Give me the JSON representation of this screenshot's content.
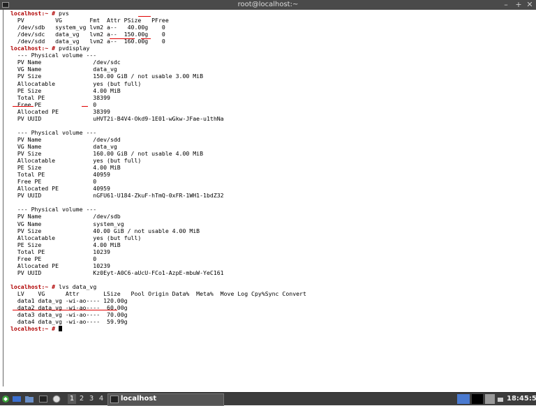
{
  "window": {
    "title": "root@localhost:~",
    "minimize": "–",
    "maximize": "+",
    "close": "✕"
  },
  "terminal": {
    "lines": [
      {
        "prompt": "localhost:~ #",
        "text": " pvs"
      },
      {
        "text": "  PV         VG        Fmt  Attr PSize   PFree"
      },
      {
        "text": "  /dev/sdb   system_vg lvm2 a--   40.00g    0"
      },
      {
        "text": "  /dev/sdc   data_vg   lvm2 a--  150.00g    0"
      },
      {
        "text": "  /dev/sdd   data_vg   lvm2 a--  160.00g    0"
      },
      {
        "prompt": "localhost:~ #",
        "text": " pvdisplay"
      },
      {
        "text": "  --- Physical volume ---"
      },
      {
        "text": "  PV Name               /dev/sdc"
      },
      {
        "text": "  VG Name               data_vg"
      },
      {
        "text": "  PV Size               150.00 GiB / not usable 3.00 MiB"
      },
      {
        "text": "  Allocatable           yes (but full)"
      },
      {
        "text": "  PE Size               4.00 MiB"
      },
      {
        "text": "  Total PE              38399"
      },
      {
        "text": "  Free PE               0"
      },
      {
        "text": "  Allocated PE          38399"
      },
      {
        "text": "  PV UUID               uHVT2i-B4V4-Okd9-1E01-wGkw-JFae-u1thNa"
      },
      {
        "text": ""
      },
      {
        "text": "  --- Physical volume ---"
      },
      {
        "text": "  PV Name               /dev/sdd"
      },
      {
        "text": "  VG Name               data_vg"
      },
      {
        "text": "  PV Size               160.00 GiB / not usable 4.00 MiB"
      },
      {
        "text": "  Allocatable           yes (but full)"
      },
      {
        "text": "  PE Size               4.00 MiB"
      },
      {
        "text": "  Total PE              40959"
      },
      {
        "text": "  Free PE               0"
      },
      {
        "text": "  Allocated PE          40959"
      },
      {
        "text": "  PV UUID               nGFU61-U184-ZkuF-hTmQ-0xFR-1WH1-1bdZ32"
      },
      {
        "text": ""
      },
      {
        "text": "  --- Physical volume ---"
      },
      {
        "text": "  PV Name               /dev/sdb"
      },
      {
        "text": "  VG Name               system_vg"
      },
      {
        "text": "  PV Size               40.00 GiB / not usable 4.00 MiB"
      },
      {
        "text": "  Allocatable           yes (but full)"
      },
      {
        "text": "  PE Size               4.00 MiB"
      },
      {
        "text": "  Total PE              10239"
      },
      {
        "text": "  Free PE               0"
      },
      {
        "text": "  Allocated PE          10239"
      },
      {
        "text": "  PV UUID               Kz0Eyt-A0C6-aUcU-FCo1-AzpE-mbuW-YeC161"
      },
      {
        "text": ""
      },
      {
        "prompt": "localhost:~ #",
        "text": " lvs data_vg"
      },
      {
        "text": "  LV    VG      Attr       LSize   Pool Origin Data%  Meta%  Move Log Cpy%Sync Convert"
      },
      {
        "text": "  data1 data_vg -wi-ao---- 120.00g"
      },
      {
        "text": "  data2 data_vg -wi-ao----  60.00g"
      },
      {
        "text": "  data3 data_vg -wi-ao----  70.00g"
      },
      {
        "text": "  data4 data_vg -wi-ao----  59.99g"
      },
      {
        "prompt": "localhost:~ #",
        "text": " ",
        "cursor": true
      }
    ]
  },
  "taskbar": {
    "workspaces": [
      "1",
      "2",
      "3",
      "4"
    ],
    "active_task": "localhost",
    "clock": "18:45:53"
  }
}
